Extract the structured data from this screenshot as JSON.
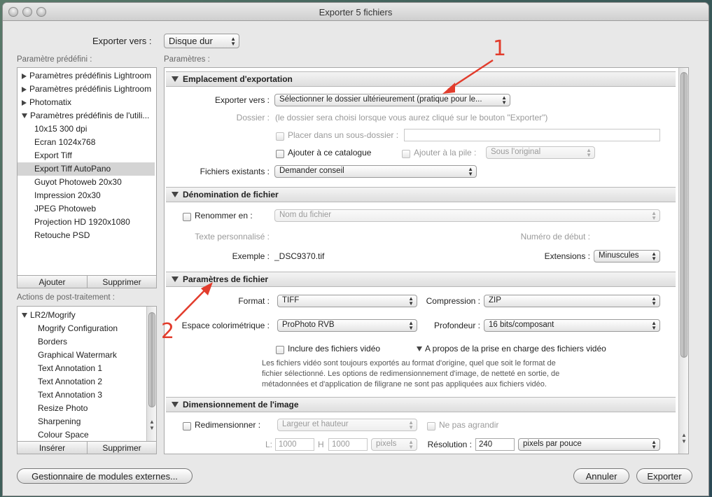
{
  "window": {
    "title": "Exporter 5 fichiers"
  },
  "export_to": {
    "label": "Exporter vers :",
    "value": "Disque dur"
  },
  "presets": {
    "header": "Paramètre prédéfini :",
    "items": [
      {
        "label": "Paramètres prédéfinis Lightroom",
        "type": "folder-closed"
      },
      {
        "label": "Paramètres prédéfinis Lightroom",
        "type": "folder-closed"
      },
      {
        "label": "Photomatix",
        "type": "folder-closed"
      },
      {
        "label": "Paramètres prédéfinis de l'utili...",
        "type": "folder-open"
      },
      {
        "label": "10x15 300 dpi",
        "type": "item"
      },
      {
        "label": "Ecran 1024x768",
        "type": "item"
      },
      {
        "label": "Export Tiff",
        "type": "item"
      },
      {
        "label": "Export Tiff AutoPano",
        "type": "item",
        "selected": true
      },
      {
        "label": "Guyot Photoweb 20x30",
        "type": "item"
      },
      {
        "label": "Impression 20x30",
        "type": "item"
      },
      {
        "label": "JPEG Photoweb",
        "type": "item"
      },
      {
        "label": "Projection HD 1920x1080",
        "type": "item"
      },
      {
        "label": "Retouche PSD",
        "type": "item"
      }
    ],
    "add_label": "Ajouter",
    "remove_label": "Supprimer"
  },
  "post_processing": {
    "header": "Actions de post-traitement :",
    "group": "LR2/Mogrify",
    "items": [
      "Mogrify Configuration",
      "Borders",
      "Graphical Watermark",
      "Text Annotation 1",
      "Text Annotation 2",
      "Text Annotation 3",
      "Resize Photo",
      "Sharpening",
      "Colour Space"
    ],
    "insert_label": "Insérer",
    "remove_label": "Supprimer"
  },
  "params_header": "Paramètres :",
  "location": {
    "title": "Emplacement d'exportation",
    "export_to_label": "Exporter vers :",
    "export_to_value": "Sélectionner le dossier ultérieurement (pratique pour le...",
    "folder_label": "Dossier :",
    "folder_note": "(le dossier sera choisi lorsque vous aurez cliqué sur le bouton \"Exporter\")",
    "subfolder_label": "Placer dans un sous-dossier :",
    "subfolder_value": "",
    "add_catalog_label": "Ajouter à ce catalogue",
    "add_stack_label": "Ajouter à la pile :",
    "stack_value": "Sous l'original",
    "existing_label": "Fichiers existants :",
    "existing_value": "Demander conseil"
  },
  "naming": {
    "title": "Dénomination de fichier",
    "rename_label": "Renommer en :",
    "rename_value": "Nom du fichier",
    "custom_text_label": "Texte personnalisé :",
    "start_number_label": "Numéro de début :",
    "example_label": "Exemple :",
    "example_value": "_DSC9370.tif",
    "extensions_label": "Extensions :",
    "extensions_value": "Minuscules"
  },
  "file_settings": {
    "title": "Paramètres de fichier",
    "format_label": "Format :",
    "format_value": "TIFF",
    "compression_label": "Compression :",
    "compression_value": "ZIP",
    "colorspace_label": "Espace colorimétrique :",
    "colorspace_value": "ProPhoto RVB",
    "depth_label": "Profondeur :",
    "depth_value": "16 bits/composant",
    "include_video_label": "Inclure des fichiers vidéo",
    "video_support_label": "A propos de la prise en charge des fichiers vidéo",
    "video_note_1": "Les fichiers vidéo sont toujours exportés au format d'origine, quel que soit le format de",
    "video_note_2": "fichier sélectionné. Les options de redimensionnement d'image, de netteté en sortie, de",
    "video_note_3": "métadonnées et d'application de filigrane ne sont pas appliquées aux fichiers vidéo."
  },
  "sizing": {
    "title": "Dimensionnement de l'image",
    "resize_label": "Redimensionner :",
    "resize_value": "Largeur et hauteur",
    "no_enlarge_label": "Ne pas agrandir",
    "w_label": "L:",
    "w_value": "1000",
    "h_label": "H",
    "h_value": "1000",
    "unit_value": "pixels",
    "resolution_label": "Résolution :",
    "resolution_value": "240",
    "resolution_unit": "pixels par pouce"
  },
  "annotations": {
    "one": "1",
    "two": "2",
    "color": "#e23c2c"
  },
  "footer": {
    "plugins_label": "Gestionnaire de modules externes...",
    "cancel_label": "Annuler",
    "export_label": "Exporter"
  }
}
